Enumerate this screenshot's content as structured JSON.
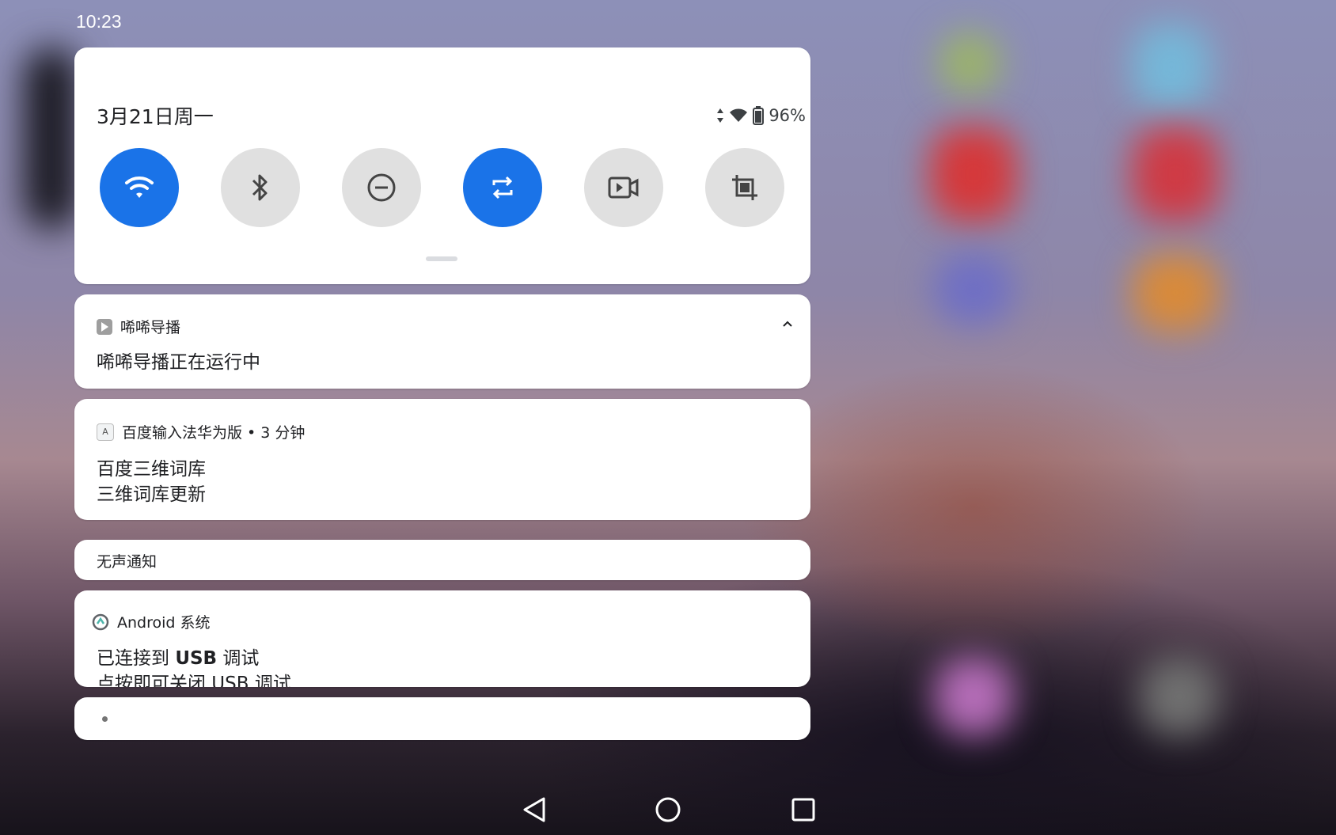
{
  "status_bar": {
    "time": "10:23"
  },
  "quick_settings": {
    "date": "3月21日周一",
    "battery": "96%",
    "tiles": [
      {
        "icon": "wifi-icon",
        "on": true
      },
      {
        "icon": "bluetooth-icon",
        "on": false
      },
      {
        "icon": "do-not-disturb-icon",
        "on": false
      },
      {
        "icon": "auto-rotate-icon",
        "on": true
      },
      {
        "icon": "screen-record-icon",
        "on": false
      },
      {
        "icon": "screenshot-crop-icon",
        "on": false
      }
    ]
  },
  "notifications": [
    {
      "app": "唏唏导播",
      "text": "唏唏导播正在运行中"
    },
    {
      "app": "百度输入法华为版 • 3 分钟",
      "title": "百度三维词库",
      "text": "三维词库更新"
    }
  ],
  "silent_section": {
    "label": "无声通知"
  },
  "android_notification": {
    "app": "Android 系统",
    "title_prefix": "已连接到 ",
    "title_bold": "USB",
    "title_suffix": " 调试",
    "text": "点按即可关闭 USB 调试"
  },
  "colors": {
    "accent": "#1a73e8",
    "tile_off": "#e0e0e0"
  }
}
